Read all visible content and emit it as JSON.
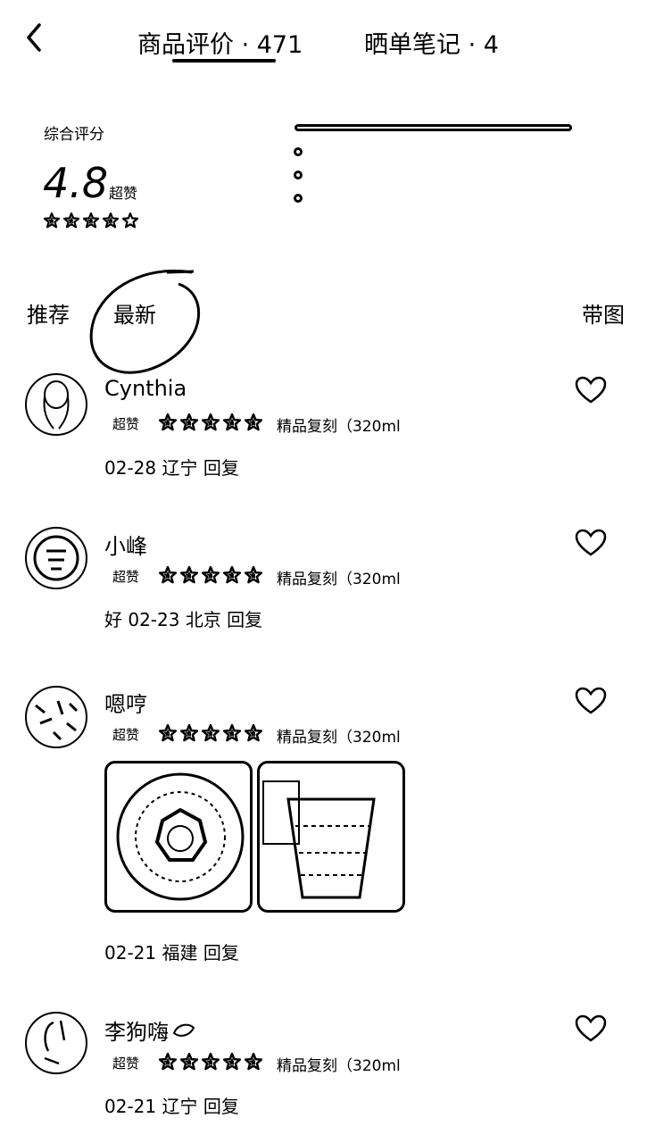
{
  "header": {
    "tab_reviews": "商品评价 · 471",
    "tab_notes": "晒单笔记 · 4"
  },
  "summary": {
    "label": "综合评分",
    "score": "4.8",
    "score_tag": "超赞",
    "stars": 4.5
  },
  "filters": {
    "recommend": "推荐",
    "latest": "最新",
    "with_image": "带图"
  },
  "reviews": [
    {
      "name": "Cynthia",
      "tag": "超赞",
      "stars": 5,
      "spec": "精品复刻（320ml",
      "meta": "02-28 辽宁 回复"
    },
    {
      "name": "小峰",
      "tag": "超赞",
      "stars": 5,
      "spec": "精品复刻（320ml",
      "meta": "好 02-23 北京 回复"
    },
    {
      "name": "嗯哼",
      "tag": "超赞",
      "stars": 5,
      "spec": "精品复刻（320ml",
      "meta": "02-21 福建 回复"
    },
    {
      "name": "李狗嗨",
      "tag": "超赞",
      "stars": 5,
      "spec": "精品复刻（320ml",
      "meta": "02-21 辽宁 回复"
    }
  ]
}
